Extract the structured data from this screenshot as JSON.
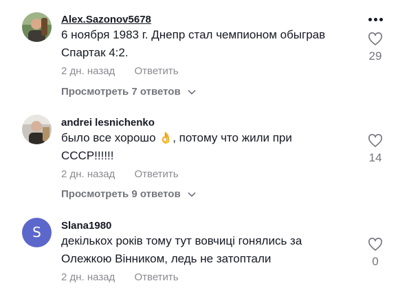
{
  "comments": [
    {
      "username": "Alex.Sazonov5678",
      "text": "6 ноября 1983 г. Днепр стал чемпионом обыграв Спартак 4:2.",
      "time": "2 дн. назад",
      "reply_label": "Ответить",
      "view_replies": "Просмотреть 7 ответов",
      "likes": "29",
      "avatar": "photo"
    },
    {
      "username": "andrei lesnichenko",
      "text_before": "было все хорошо ",
      "emoji": "👌",
      "text_after": ", потому что жили при СССР!!!!!!",
      "time": "2 дн. назад",
      "reply_label": "Ответить",
      "view_replies": "Просмотреть 9 ответов",
      "likes": "14",
      "avatar": "photo"
    },
    {
      "username": "Slana1980",
      "avatar_letter": "S",
      "text": "декількох років тому тут вовчиці гонялись за Олежкою Вінником, ледь не затоптали",
      "time": "2 дн. назад",
      "reply_label": "Ответить",
      "likes": "0",
      "avatar_color": "#5b67ca"
    }
  ],
  "colors": {
    "text": "#161823",
    "secondary": "#8a8b91",
    "avatar_letter_bg": "#5b67ca"
  }
}
